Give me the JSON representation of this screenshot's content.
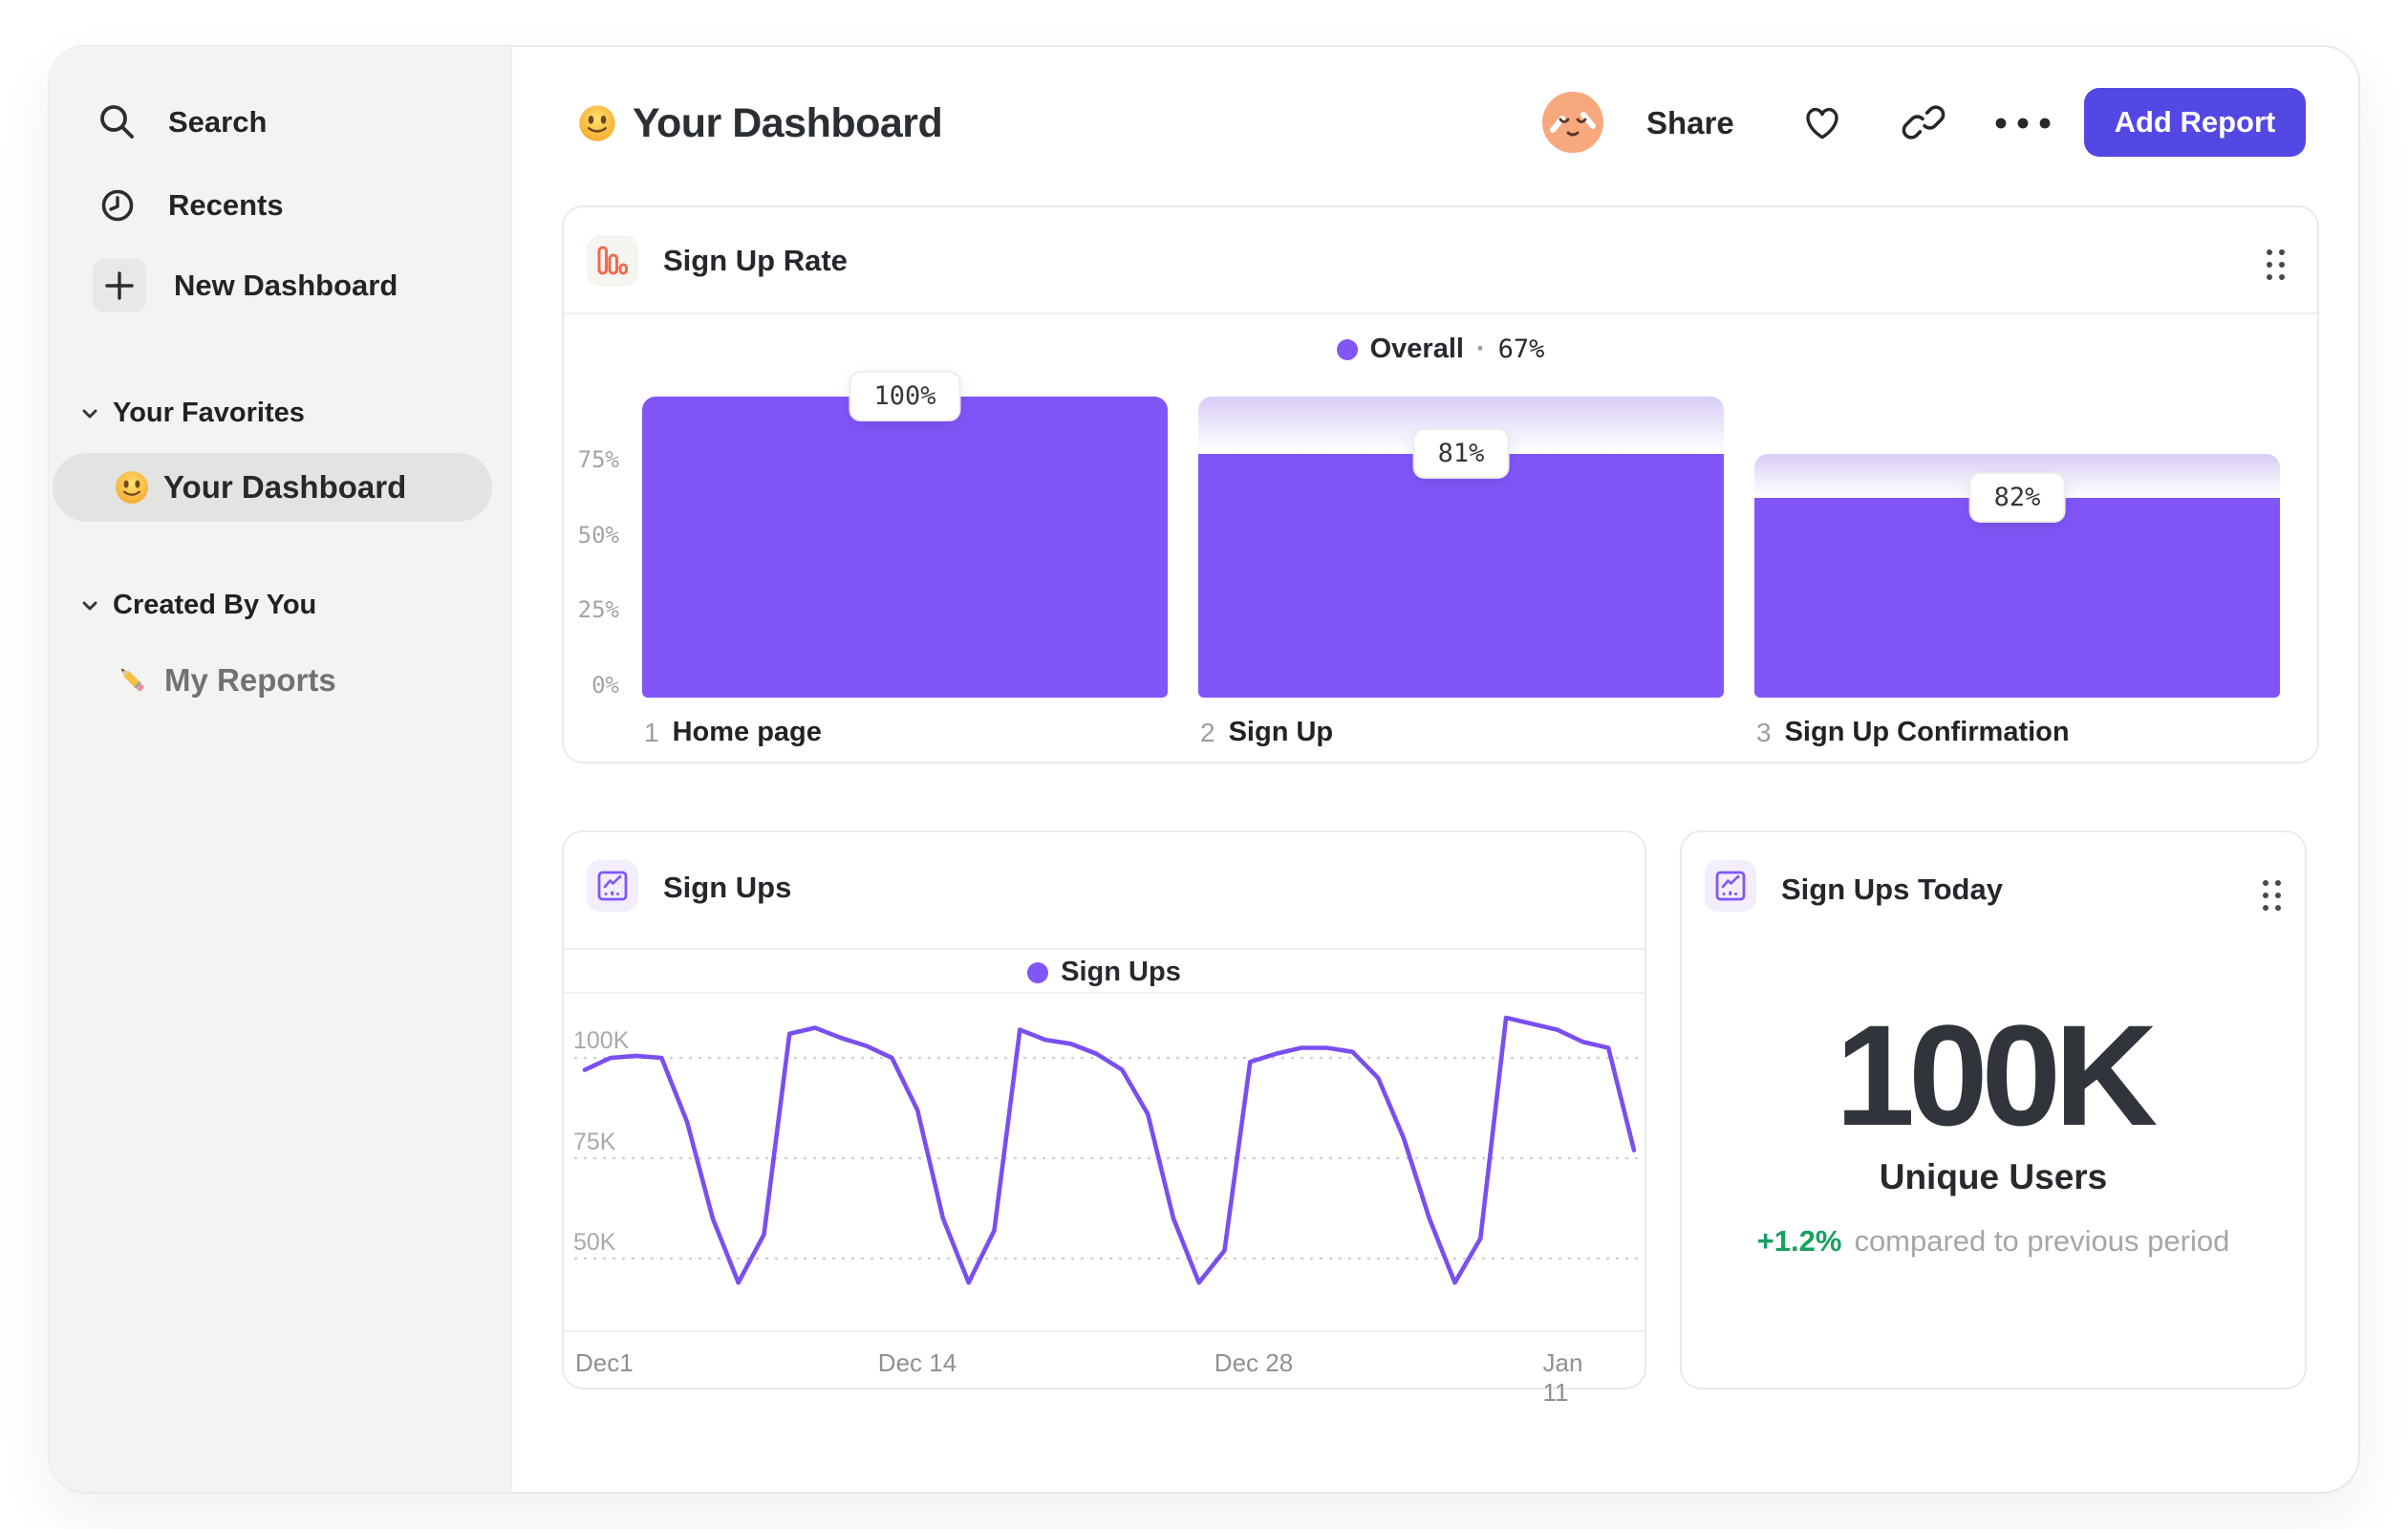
{
  "colors": {
    "accent_purple": "#8156F7",
    "line_purple": "#7A4EF0",
    "button_indigo": "#5348E4",
    "positive_green": "#17A05F",
    "icon_orange": "#F2694C",
    "sidebar_bg": "#F3F3F1",
    "selected_pill_bg": "#E3E3E1"
  },
  "sidebar": {
    "search": "Search",
    "recents": "Recents",
    "new_dashboard": "New Dashboard",
    "sections": [
      {
        "label": "Your Favorites",
        "items": [
          {
            "icon": "smiley-emoji",
            "label": "Your Dashboard",
            "selected": true
          }
        ]
      },
      {
        "label": "Created By You",
        "items": [
          {
            "icon": "pencil-emoji",
            "label": "My Reports",
            "selected": false
          }
        ]
      }
    ]
  },
  "header": {
    "title_emoji": "slightly-smiling-face",
    "title": "Your Dashboard",
    "share": "Share",
    "add_report": "Add Report"
  },
  "cards": {
    "sign_up_rate": {
      "title": "Sign Up Rate",
      "legend_label": "Overall",
      "legend_sep": "·",
      "legend_value": "67%"
    },
    "sign_ups": {
      "title": "Sign Ups",
      "legend_label": "Sign Ups"
    },
    "sign_ups_today": {
      "title": "Sign Ups Today",
      "value": "100K",
      "unit_label": "Unique Users",
      "delta": "+1.2%",
      "delta_note": "compared to previous period"
    }
  },
  "icons": {
    "search-icon": "magnifier",
    "clock-icon": "recents clock",
    "plus-icon": "plus",
    "chevron-down-icon": "section collapse caret",
    "smiley-emoji": "slightly smiling face",
    "pencil-emoji": "pencil",
    "avatar-face": "peach relieved face avatar",
    "heart-icon": "favorite heart outline",
    "link-icon": "copy link chain",
    "more-icon": "ellipsis three dots",
    "drag-handle-icon": "six dot drag grip",
    "bar-chart-icon": "orange funnel bars",
    "line-chart-icon": "purple line chart in square"
  },
  "chart_data": [
    {
      "type": "bar",
      "subtype": "funnel",
      "title": "Sign Up Rate",
      "legend": "Overall · 67%",
      "overall_conversion_pct": 67,
      "categories": [
        "Home page",
        "Sign Up",
        "Sign Up Confirmation"
      ],
      "step_numbers": [
        "1",
        "2",
        "3"
      ],
      "values": [
        100,
        81,
        82
      ],
      "value_labels": [
        "100%",
        "81%",
        "82%"
      ],
      "yticks": [
        "75%",
        "50%",
        "25%",
        "0%"
      ],
      "ytick_values": [
        75,
        50,
        25,
        0
      ],
      "ylim": [
        0,
        100
      ],
      "bar_color": "#8155F8",
      "legend_position": "top-center"
    },
    {
      "type": "line",
      "title": "Sign Ups",
      "legend": "Sign Ups",
      "x_ticks": [
        "Dec1",
        "Dec 14",
        "Dec 28",
        "Jan 11"
      ],
      "y_ticks": [
        "100K",
        "75K",
        "50K"
      ],
      "y_tick_values_k": [
        100,
        75,
        50
      ],
      "ylim_k": [
        38,
        114
      ],
      "grid": "dashed-horizontal",
      "line_color": "#7A4EF0",
      "series": [
        {
          "name": "Sign Ups",
          "unit": "K users per day",
          "start": "Dec 1",
          "end": "Jan 11",
          "values": [
            97,
            100,
            100.5,
            100,
            84,
            60,
            44,
            56,
            106,
            107.5,
            105,
            103,
            100,
            87,
            60,
            44,
            57,
            107,
            104.5,
            103.5,
            101,
            97,
            86,
            60,
            44,
            52,
            99,
            101,
            102.5,
            102.5,
            101.5,
            95,
            80,
            60,
            44,
            55,
            110,
            108.5,
            107,
            104,
            102.5,
            77
          ]
        }
      ]
    },
    {
      "type": "number",
      "title": "Sign Ups Today",
      "value": "100K",
      "label": "Unique Users",
      "delta": "+1.2%",
      "delta_note": "compared to previous period",
      "delta_color": "#17A05F"
    }
  ]
}
